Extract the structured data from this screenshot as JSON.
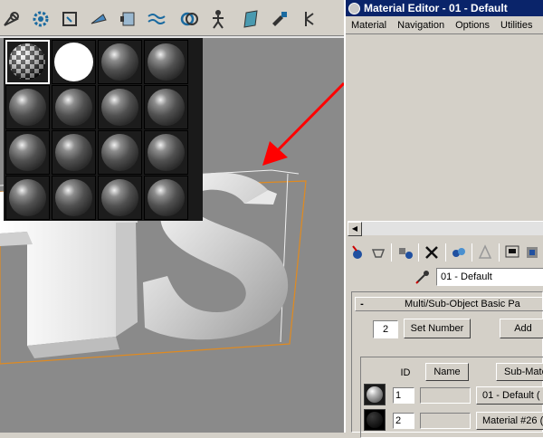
{
  "material_editor": {
    "title": "Material Editor - 01 - Default",
    "menu": [
      "Material",
      "Navigation",
      "Options",
      "Utilities"
    ],
    "current_material": "01 - Default",
    "rollout_title": "Multi/Sub-Object Basic Pa",
    "count_value": "2",
    "set_number_label": "Set Number",
    "add_label": "Add",
    "columns": {
      "id": "ID",
      "name": "Name",
      "sub_material": "Sub-Mate"
    },
    "rows": [
      {
        "id": "1",
        "sub_material": "01 - Default  ("
      },
      {
        "id": "2",
        "sub_material": "Material #26  ("
      }
    ]
  },
  "viewport": {
    "text": "TS"
  },
  "colors": {
    "title_bar": "#0a246a",
    "viewport_bg": "#8a8a8a",
    "arrow": "#ff0000",
    "bbox": "#e08a20"
  },
  "icons": [
    "select-icon",
    "gear-icon",
    "geometry-icon",
    "lights-icon",
    "cameras-icon",
    "spacewarp-icon",
    "link-icon",
    "biped-icon",
    "bone-icon",
    "helpers-icon",
    "systems-icon",
    "reset-map-icon",
    "get-material-icon",
    "delete-icon",
    "put-library-icon",
    "show-map-icon",
    "go-parent-icon",
    "eyedropper-icon"
  ]
}
